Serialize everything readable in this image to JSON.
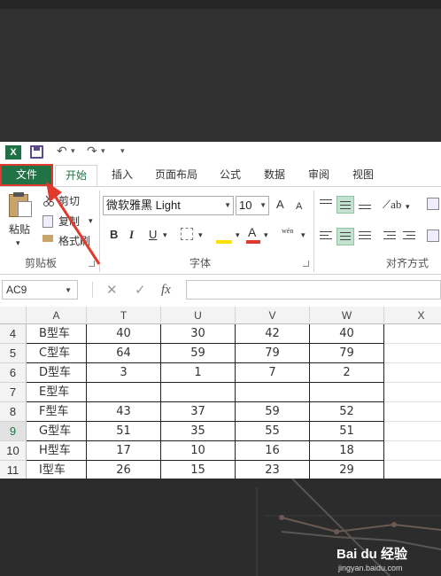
{
  "app": {
    "logo": "X",
    "quick_access": {
      "undo": "↶",
      "undo_menu": "▾",
      "redo": "↷",
      "redo_menu": "▾",
      "customize": "▾"
    }
  },
  "tabs": [
    {
      "label": "文件"
    },
    {
      "label": "开始"
    },
    {
      "label": "插入"
    },
    {
      "label": "页面布局"
    },
    {
      "label": "公式"
    },
    {
      "label": "数据"
    },
    {
      "label": "审阅"
    },
    {
      "label": "视图"
    }
  ],
  "ribbon": {
    "clipboard": {
      "paste": "粘贴",
      "cut": "剪切",
      "copy": "复制",
      "format_painter": "格式刷",
      "group_label": "剪贴板"
    },
    "font": {
      "font_name": "微软雅黑 Light",
      "font_size": "10",
      "grow": "A",
      "shrink": "A",
      "bold": "B",
      "italic": "I",
      "underline": "U",
      "phonetic": "wén",
      "group_label": "字体"
    },
    "alignment": {
      "group_label": "对齐方式"
    }
  },
  "formula_bar": {
    "name_box": "AC9",
    "cancel": "✕",
    "enter": "✓",
    "fx": "fx",
    "value": ""
  },
  "sheet": {
    "columns": [
      "A",
      "T",
      "U",
      "V",
      "W",
      "X"
    ],
    "rows": [
      {
        "num": "4",
        "cells": [
          "B型车",
          "40",
          "30",
          "42",
          "40"
        ]
      },
      {
        "num": "5",
        "cells": [
          "C型车",
          "64",
          "59",
          "79",
          "79"
        ]
      },
      {
        "num": "6",
        "cells": [
          "D型车",
          "3",
          "1",
          "7",
          "2"
        ]
      },
      {
        "num": "7",
        "cells": [
          "E型车",
          "",
          "",
          "",
          ""
        ]
      },
      {
        "num": "8",
        "cells": [
          "F型车",
          "43",
          "37",
          "59",
          "52"
        ]
      },
      {
        "num": "9",
        "cells": [
          "G型车",
          "51",
          "35",
          "55",
          "51"
        ]
      },
      {
        "num": "10",
        "cells": [
          "H型车",
          "17",
          "10",
          "16",
          "18"
        ]
      },
      {
        "num": "11",
        "cells": [
          "I型车",
          "26",
          "15",
          "23",
          "29"
        ]
      }
    ]
  },
  "watermark": {
    "brand": "Bai du 经验",
    "url": "jingyan.baidu.com"
  },
  "colors": {
    "excel_green": "#217346",
    "annotation_red": "#e03a2e"
  }
}
